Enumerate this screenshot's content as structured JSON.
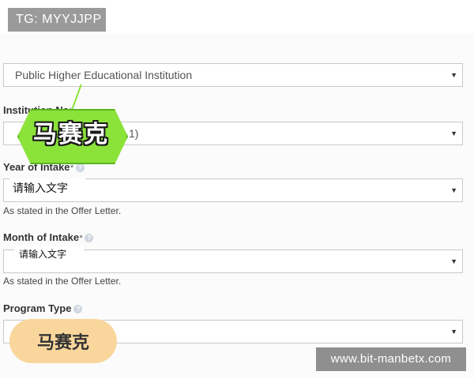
{
  "watermarks": {
    "top_left": "TG: MYYJJPP",
    "bottom_right": "www.bit-manbetx.com"
  },
  "form": {
    "institution_type": {
      "value": "Public Higher Educational Institution"
    },
    "institution_name": {
      "label": "Institution Na",
      "required_mark": "*",
      "partial_value": "1)"
    },
    "year_of_intake": {
      "label": "Year of Intake",
      "required_mark": "*",
      "overlay_text": "请输入文字",
      "hint": "As stated in the Offer Letter."
    },
    "month_of_intake": {
      "label": "Month of Intake",
      "required_mark": "*",
      "overlay_text": "请输入文字",
      "hint": "As stated in the Offer Letter."
    },
    "program_type": {
      "label": "Program Type"
    }
  },
  "callouts": {
    "green": "马赛克",
    "orange": "马赛克"
  },
  "colors": {
    "callout_green": "#8be33a",
    "callout_orange": "#f9d79c",
    "border": "#c8c8c8"
  },
  "icons": {
    "dropdown": "triangle-down",
    "help": "question-circle"
  }
}
